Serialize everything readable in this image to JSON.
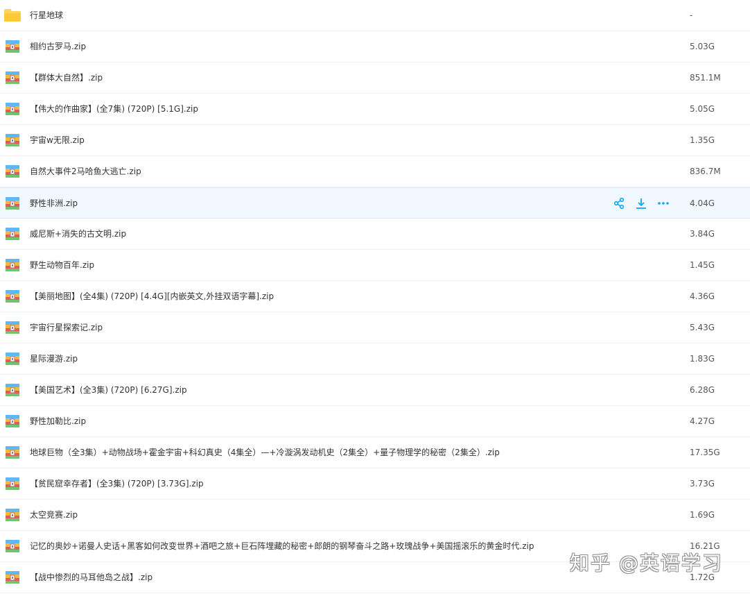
{
  "files": [
    {
      "name": "行星地球",
      "size": "-",
      "type": "folder"
    },
    {
      "name": "相约古罗马.zip",
      "size": "5.03G",
      "type": "zip"
    },
    {
      "name": "【群体大自然】.zip",
      "size": "851.1M",
      "type": "zip"
    },
    {
      "name": "【伟大的作曲家】(全7集) (720P) [5.1G].zip",
      "size": "5.05G",
      "type": "zip"
    },
    {
      "name": "宇宙w无限.zip",
      "size": "1.35G",
      "type": "zip"
    },
    {
      "name": "自然大事件2马哈鱼大逃亡.zip",
      "size": "836.7M",
      "type": "zip"
    },
    {
      "name": "野性非洲.zip",
      "size": "4.04G",
      "type": "zip",
      "hover": true
    },
    {
      "name": "威尼斯+消失的古文明.zip",
      "size": "3.84G",
      "type": "zip"
    },
    {
      "name": "野生动物百年.zip",
      "size": "1.45G",
      "type": "zip"
    },
    {
      "name": "【美丽地图】(全4集) (720P) [4.4G][内嵌英文,外挂双语字幕].zip",
      "size": "4.36G",
      "type": "zip"
    },
    {
      "name": "宇宙行星探索记.zip",
      "size": "5.43G",
      "type": "zip"
    },
    {
      "name": "星际漫游.zip",
      "size": "1.83G",
      "type": "zip"
    },
    {
      "name": "【美国艺术】(全3集) (720P) [6.27G].zip",
      "size": "6.28G",
      "type": "zip"
    },
    {
      "name": "野性加勒比.zip",
      "size": "4.27G",
      "type": "zip"
    },
    {
      "name": "地球巨物（全3集）+动物战场+霍金宇宙+科幻真史（4集全）—+冷漩涡发动机史（2集全）+量子物理学的秘密（2集全）.zip",
      "size": "17.35G",
      "type": "zip"
    },
    {
      "name": "【贫民窟幸存者】(全3集) (720P) [3.73G].zip",
      "size": "3.73G",
      "type": "zip"
    },
    {
      "name": "太空竞赛.zip",
      "size": "1.69G",
      "type": "zip"
    },
    {
      "name": "记忆的奥妙+诺曼人史话+黑客如何改变世界+酒吧之旅+巨石阵埋藏的秘密+郎朗的钢琴奋斗之路+玫瑰战争+美国摇滚乐的黄金时代.zip",
      "size": "16.21G",
      "type": "zip"
    },
    {
      "name": "【战中惨烈的马耳他岛之战】.zip",
      "size": "1.72G",
      "type": "zip"
    }
  ],
  "row_actions": {
    "icons": [
      "share-icon",
      "download-icon",
      "more-icon"
    ]
  },
  "colors": {
    "accent": "#06a7ff",
    "folder": "#ffd45b",
    "hover_bg": "#f2f8ff"
  },
  "watermark": {
    "text": "知乎 @英语学习"
  }
}
